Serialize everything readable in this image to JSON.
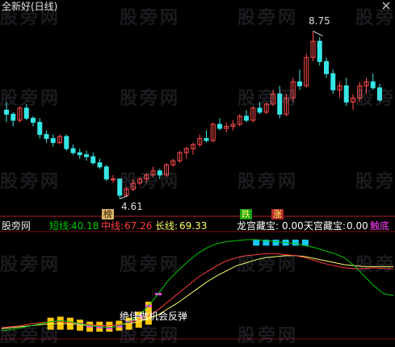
{
  "upper": {
    "title": "全新好(日线)",
    "high_label": "8.75",
    "low_label": "4.61",
    "marker_bang": "榜",
    "marker_die": "跌",
    "marker_zhang": "涨",
    "close_icon": "close-x-icon"
  },
  "lower": {
    "name": "股旁网",
    "short_label": "短线:",
    "short_value": "40.18",
    "mid_label": "中线:",
    "mid_value": "67.26",
    "long_label": "长线:",
    "long_value": "69.33",
    "dragon_label": "龙宫藏宝:",
    "dragon_value": "0.00",
    "sky_label": "天宫藏宝:",
    "sky_value": "0.00",
    "bottom_label": "触底",
    "rebound_text": "绝佳做机会反弹"
  },
  "watermark": "股旁网",
  "colors": {
    "up": "#ff4b4b",
    "down": "#36e6e6",
    "short": "#00c800",
    "mid": "#ff3c3c",
    "long": "#ffff64",
    "bottom": "#ff40ff",
    "bar_yellow": "#ffc800",
    "bar_cyan": "#19c8ff"
  },
  "chart_data": {
    "type": "candlestick",
    "candles": [
      [
        6.8,
        7.0,
        6.5,
        6.7
      ],
      [
        6.7,
        6.75,
        6.4,
        6.55
      ],
      [
        6.55,
        6.9,
        6.5,
        6.85
      ],
      [
        6.85,
        6.95,
        6.55,
        6.6
      ],
      [
        6.6,
        6.65,
        6.4,
        6.5
      ],
      [
        6.5,
        6.6,
        6.1,
        6.2
      ],
      [
        6.2,
        6.3,
        6.0,
        6.1
      ],
      [
        6.1,
        6.2,
        5.9,
        6.0
      ],
      [
        6.0,
        6.2,
        5.95,
        6.15
      ],
      [
        6.15,
        6.2,
        5.8,
        5.85
      ],
      [
        5.85,
        5.95,
        5.7,
        5.75
      ],
      [
        5.75,
        5.85,
        5.6,
        5.7
      ],
      [
        5.7,
        5.8,
        5.55,
        5.65
      ],
      [
        5.65,
        5.75,
        5.45,
        5.5
      ],
      [
        5.5,
        5.6,
        5.35,
        5.4
      ],
      [
        5.4,
        5.45,
        5.05,
        5.1
      ],
      [
        5.1,
        5.2,
        5.0,
        5.1
      ],
      [
        5.1,
        5.1,
        4.61,
        4.7
      ],
      [
        4.7,
        4.9,
        4.65,
        4.85
      ],
      [
        4.85,
        5.1,
        4.8,
        5.0
      ],
      [
        5.0,
        5.15,
        4.95,
        5.1
      ],
      [
        5.1,
        5.25,
        5.0,
        5.2
      ],
      [
        5.2,
        5.4,
        5.15,
        5.3
      ],
      [
        5.3,
        5.35,
        5.1,
        5.2
      ],
      [
        5.2,
        5.5,
        5.15,
        5.45
      ],
      [
        5.45,
        5.6,
        5.4,
        5.55
      ],
      [
        5.55,
        5.8,
        5.5,
        5.75
      ],
      [
        5.75,
        5.9,
        5.6,
        5.85
      ],
      [
        5.85,
        6.0,
        5.7,
        5.95
      ],
      [
        5.95,
        6.2,
        5.9,
        6.1
      ],
      [
        6.1,
        6.3,
        6.0,
        6.05
      ],
      [
        6.05,
        6.5,
        6.0,
        6.45
      ],
      [
        6.45,
        6.6,
        6.3,
        6.35
      ],
      [
        6.35,
        6.5,
        6.25,
        6.4
      ],
      [
        6.4,
        6.55,
        6.3,
        6.45
      ],
      [
        6.45,
        6.7,
        6.4,
        6.65
      ],
      [
        6.65,
        6.8,
        6.5,
        6.55
      ],
      [
        6.55,
        6.9,
        6.5,
        6.85
      ],
      [
        6.85,
        7.0,
        6.7,
        6.75
      ],
      [
        6.75,
        7.0,
        6.7,
        6.95
      ],
      [
        6.95,
        7.3,
        6.9,
        7.2
      ],
      [
        7.2,
        7.4,
        6.6,
        6.7
      ],
      [
        6.7,
        7.2,
        6.65,
        7.1
      ],
      [
        7.1,
        7.6,
        7.0,
        7.5
      ],
      [
        7.5,
        7.8,
        7.3,
        7.4
      ],
      [
        7.4,
        8.2,
        7.35,
        8.1
      ],
      [
        8.1,
        8.75,
        8.0,
        8.5
      ],
      [
        8.5,
        8.6,
        7.9,
        8.0
      ],
      [
        8.0,
        8.1,
        7.6,
        7.7
      ],
      [
        7.7,
        7.8,
        7.2,
        7.3
      ],
      [
        7.3,
        7.5,
        7.1,
        7.4
      ],
      [
        7.4,
        7.6,
        6.9,
        7.0
      ],
      [
        7.0,
        7.2,
        6.8,
        7.1
      ],
      [
        7.1,
        7.5,
        7.0,
        7.4
      ],
      [
        7.4,
        7.6,
        7.2,
        7.5
      ],
      [
        7.5,
        7.7,
        7.3,
        7.35
      ],
      [
        7.35,
        7.45,
        7.0,
        7.05
      ]
    ],
    "ylim": [
      4.3,
      9.2
    ],
    "indicator": {
      "short": [
        5,
        6,
        8,
        10,
        12,
        14,
        15,
        14,
        12,
        10,
        9,
        8,
        10,
        14,
        20,
        30,
        42,
        55,
        65,
        74,
        82,
        88,
        92,
        94,
        95,
        96,
        96,
        95,
        94,
        93,
        92,
        90,
        88,
        85,
        82,
        78,
        70,
        60,
        50,
        42,
        40
      ],
      "mid": [
        8,
        9,
        10,
        12,
        13,
        14,
        14,
        13,
        12,
        11,
        10,
        10,
        11,
        13,
        16,
        20,
        26,
        34,
        42,
        50,
        58,
        64,
        70,
        75,
        78,
        80,
        81,
        82,
        82,
        81,
        80,
        78,
        75,
        72,
        70,
        68,
        67,
        67,
        68,
        67,
        67
      ],
      "long": [
        7,
        8,
        9,
        10,
        11,
        12,
        12,
        12,
        11,
        10,
        10,
        10,
        11,
        12,
        14,
        17,
        21,
        27,
        33,
        40,
        47,
        54,
        60,
        65,
        70,
        73,
        76,
        78,
        79,
        80,
        80,
        79,
        77,
        75,
        73,
        71,
        70,
        69,
        69,
        69,
        69
      ]
    }
  }
}
